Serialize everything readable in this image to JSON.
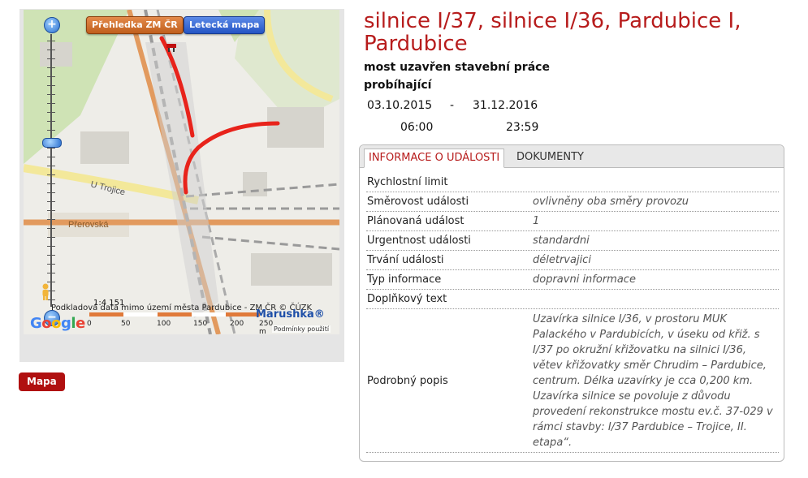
{
  "map": {
    "overview_button": "Přehledka ZM ČR",
    "aerial_button": "Letecká mapa",
    "zoom_in": "+",
    "zoom_out": "−",
    "street_labels": [
      "U Trojice",
      "Přerovská"
    ],
    "scale_ratio": "1:4 151",
    "attribution": "Podkladová data mimo území města Pardubice - ZM ČR © ČÚZK",
    "scale_labels": [
      "0",
      "50",
      "100",
      "150",
      "200",
      "250 m"
    ],
    "brand": "Marushka®",
    "terms": "Podmínky použití",
    "google": [
      "G",
      "o",
      "o",
      "g",
      "l",
      "e"
    ],
    "colors": {
      "route": "#e8231b",
      "road_major": "#e29a5e",
      "rail": "#9a9a9a"
    }
  },
  "mapa_button": "Mapa",
  "event": {
    "title": "silnice I/37, silnice I/36, Pardubice I, Pardubice",
    "subtitle": "most uzavřen stavební práce",
    "status": "probíhající",
    "date_from": "03.10.2015",
    "date_sep": "-",
    "date_to": "31.12.2016",
    "time_from": "06:00",
    "time_to": "23:59"
  },
  "tabs": {
    "info": "INFORMACE O UDÁLOSTI",
    "docs": "DOKUMENTY"
  },
  "details": [
    {
      "label": "Rychlostní limit",
      "value": ""
    },
    {
      "label": "Směrovost události",
      "value": "ovlivněny oba směry provozu"
    },
    {
      "label": "Plánovaná událost",
      "value": "1"
    },
    {
      "label": "Urgentnost události",
      "value": "standardni"
    },
    {
      "label": "Trvání události",
      "value": "déletrvajici"
    },
    {
      "label": "Typ informace",
      "value": "dopravni informace"
    },
    {
      "label": "Doplňkový text",
      "value": ""
    },
    {
      "label": "Podrobný popis",
      "value": "Uzavírka silnice I/36, v prostoru MUK Palackého v Pardubicích, v úseku od křiž. s I/37 po okružní křižovatku na silnici I/36, větev křižovatky směr Chrudim – Pardubice, centrum. Délka uzavírky je cca 0,200 km. Uzavírka silnice se povoluje z důvodu provedení rekonstrukce mostu ev.č. 37-029 v rámci stavby: I/37 Pardubice – Trojice, II. etapa“."
    }
  ]
}
